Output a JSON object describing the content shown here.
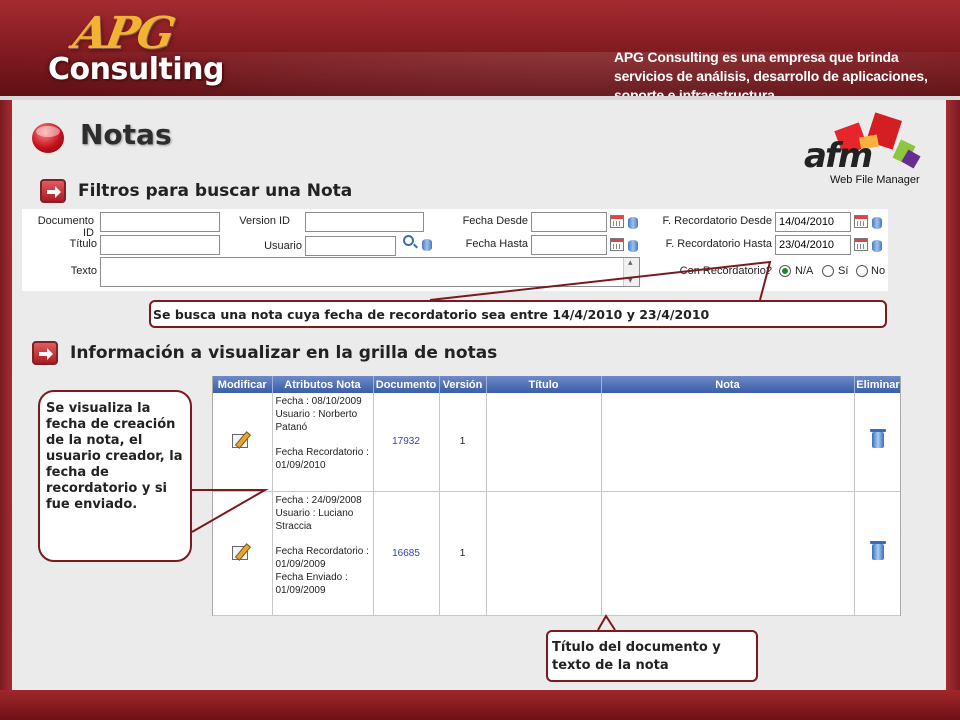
{
  "header": {
    "logo_top": "APG",
    "logo_bottom": "Consulting",
    "tagline": "APG Consulting es una empresa que brinda servicios de análisis, desarrollo de aplicaciones, soporte e infraestructura."
  },
  "page": {
    "title": "Notas",
    "afm_logo": "afm",
    "afm_subtitle": "Web File Manager"
  },
  "filters": {
    "section_title": "Filtros para buscar una Nota",
    "labels": {
      "documento_id": "Documento ID",
      "version_id": "Version ID",
      "fecha_desde": "Fecha Desde",
      "recordatorio_desde": "F. Recordatorio Desde",
      "titulo": "Título",
      "usuario": "Usuario",
      "fecha_hasta": "Fecha Hasta",
      "recordatorio_hasta": "F. Recordatorio Hasta",
      "texto": "Texto",
      "con_recordatorio": "Con Recordatorio?"
    },
    "values": {
      "recordatorio_desde": "14/04/2010",
      "recordatorio_hasta": "23/04/2010"
    },
    "radio_options": [
      "N/A",
      "Sí",
      "No"
    ],
    "radio_selected": "N/A"
  },
  "grid": {
    "section_title": "Información a visualizar en la grilla de notas",
    "columns": [
      "Modificar",
      "Atributos Nota",
      "Documento",
      "Versión",
      "Título",
      "Nota",
      "Eliminar"
    ],
    "rows": [
      {
        "attr_lines": [
          "Fecha : 08/10/2009",
          "Usuario : Norberto Patanó",
          "",
          "Fecha Recordatorio : 01/09/2010"
        ],
        "documento": "17932",
        "version": "1"
      },
      {
        "attr_lines": [
          "Fecha : 24/09/2008",
          "Usuario : Luciano Straccia",
          "",
          "Fecha Recordatorio : 01/09/2009",
          "Fecha Enviado : 01/09/2009"
        ],
        "documento": "16685",
        "version": "1"
      }
    ]
  },
  "callouts": {
    "filter": "Se busca una nota cuya fecha de recordatorio sea entre 14/4/2010 y 23/4/2010",
    "info": "Se visualiza la fecha de creación de la nota, el usuario creador, la fecha de recordatorio y si fue enviado.",
    "note": "Título del documento y texto de la nota"
  }
}
